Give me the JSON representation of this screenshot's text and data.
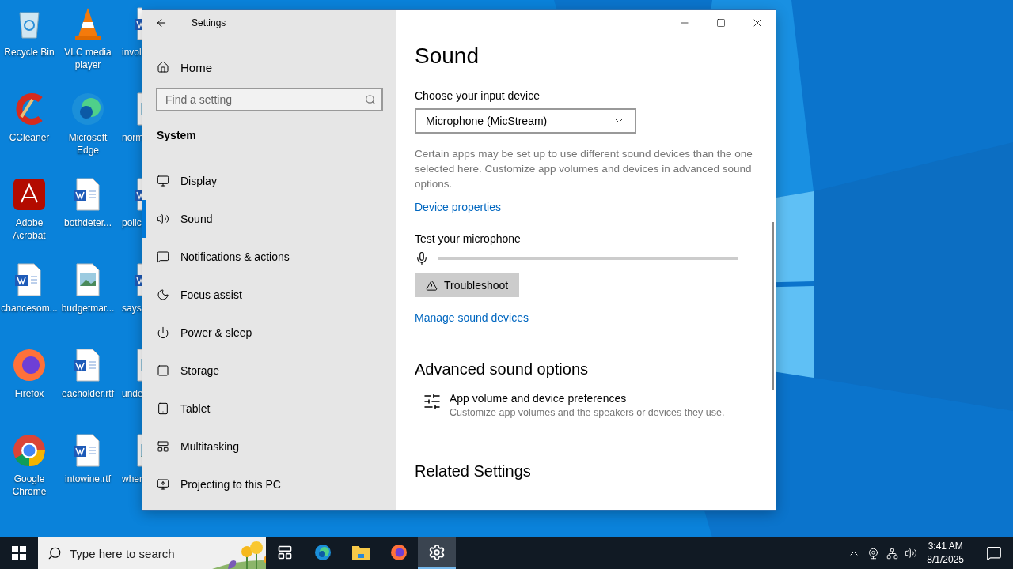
{
  "desktop_columns": [
    [
      {
        "label": "Recycle Bin",
        "kind": "bin"
      },
      {
        "label": "CCleaner",
        "kind": "cleaner"
      },
      {
        "label": "Adobe Acrobat",
        "kind": "acrobat"
      },
      {
        "label": "chancesom...",
        "kind": "document"
      },
      {
        "label": "Firefox",
        "kind": "firefox"
      },
      {
        "label": "Google Chrome",
        "kind": "chrome"
      }
    ],
    [
      {
        "label": "VLC media player",
        "kind": "cone"
      },
      {
        "label": "Microsoft Edge",
        "kind": "edge"
      },
      {
        "label": "bothdeter...",
        "kind": "document"
      },
      {
        "label": "budgetmar..."
      },
      {
        "label": "eacholder.rtf",
        "kind": "document"
      },
      {
        "label": "intowine.rtf",
        "kind": "document"
      }
    ],
    [
      {
        "label": "invol",
        "kind": "document"
      },
      {
        "label": "norm"
      },
      {
        "label": "polic",
        "kind": "document"
      },
      {
        "label": "says",
        "kind": "document"
      },
      {
        "label": "unde"
      },
      {
        "label": "wher"
      }
    ]
  ],
  "window": {
    "title": "Settings",
    "sidebar": {
      "home": "Home",
      "search": {
        "placeholder": "Find a setting"
      },
      "section": "System",
      "items": [
        {
          "label": "Display",
          "selected": false
        },
        {
          "label": "Sound",
          "selected": true
        },
        {
          "label": "Notifications & actions",
          "selected": false
        },
        {
          "label": "Focus assist",
          "selected": false
        },
        {
          "label": "Power & sleep",
          "selected": false
        },
        {
          "label": "Storage",
          "selected": false
        },
        {
          "label": "Tablet",
          "selected": false
        },
        {
          "label": "Multitasking",
          "selected": false
        },
        {
          "label": "Projecting to this PC",
          "selected": false
        }
      ]
    },
    "content": {
      "heading": "Sound",
      "input_label": "Choose your input device",
      "input_device": "Microphone (MicStream)",
      "description": "Certain apps may be set up to use different sound devices than the one selected here. Customize app volumes and devices in advanced sound options.",
      "device_properties": "Device properties",
      "test_label": "Test your microphone",
      "level": 0,
      "troubleshoot": "Troubleshoot",
      "manage_devices": "Manage sound devices",
      "advanced_heading": "Advanced sound options",
      "advanced_title": "App volume and device preferences",
      "advanced_subtitle": "Customize app volumes and the speakers or devices they use.",
      "related_heading": "Related Settings"
    }
  },
  "taskbar": {
    "search": {
      "placeholder": "Type here to search"
    },
    "apps": [
      {
        "kind": "taskview",
        "selected": false
      },
      {
        "kind": "edge",
        "selected": false
      },
      {
        "kind": "explorer",
        "selected": false
      },
      {
        "kind": "firefox",
        "selected": false
      },
      {
        "kind": "settings",
        "selected": true
      }
    ],
    "time": "3:41 AM",
    "date": "8/1/2025"
  }
}
